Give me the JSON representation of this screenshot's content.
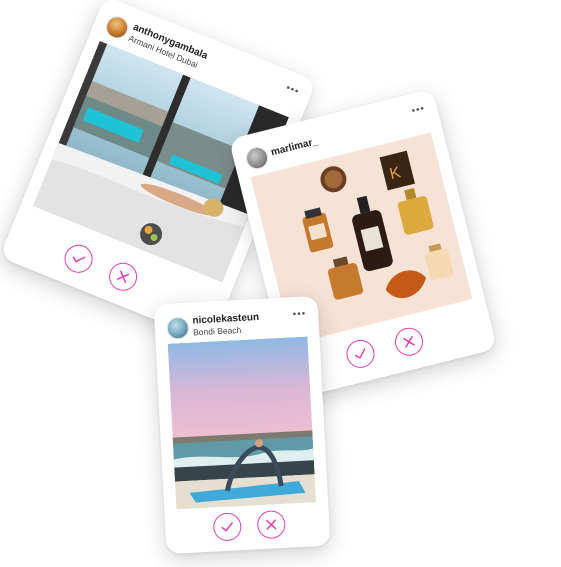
{
  "posts": [
    {
      "username": "anthonygambala",
      "location": "Armani Hotel Dubai",
      "more": "•••",
      "photo_icon": "hotel-room-photo",
      "accept_icon": "check-icon",
      "reject_icon": "close-icon"
    },
    {
      "username": "marlimar_",
      "location": "",
      "more": "•••",
      "photo_icon": "perfume-bottles-photo",
      "accept_icon": "check-icon",
      "reject_icon": "close-icon"
    },
    {
      "username": "nicolekasteun",
      "location": "Bondi Beach",
      "more": "•••",
      "photo_icon": "beach-yoga-photo",
      "accept_icon": "check-icon",
      "reject_icon": "close-icon"
    }
  ],
  "colors": {
    "accent": "#e43fb2",
    "text": "#222222"
  }
}
